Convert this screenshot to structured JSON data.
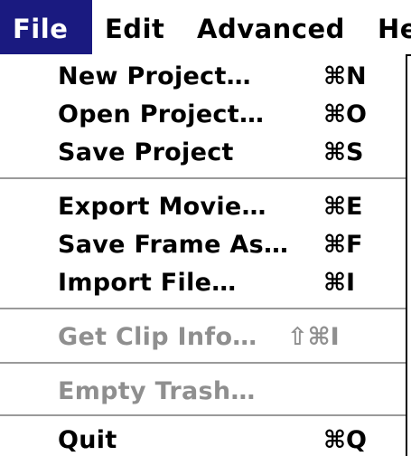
{
  "menubar": {
    "file": "File",
    "edit": "Edit",
    "advanced": "Advanced",
    "help_partial": "He",
    "active_color": "#1a1a80"
  },
  "file_menu": {
    "new_project": {
      "label": "New Project…",
      "shortcut": "⌘N"
    },
    "open_project": {
      "label": "Open Project…",
      "shortcut": "⌘O"
    },
    "save_project": {
      "label": "Save Project",
      "shortcut": "⌘S"
    },
    "export_movie": {
      "label": "Export Movie…",
      "shortcut": "⌘E"
    },
    "save_frame_as": {
      "label": "Save Frame As…",
      "shortcut": "⌘F"
    },
    "import_file": {
      "label": "Import File…",
      "shortcut": "⌘I"
    },
    "get_clip_info": {
      "label": "Get Clip Info…",
      "shortcut": "⇧⌘I",
      "disabled": true
    },
    "empty_trash": {
      "label": "Empty Trash…",
      "shortcut": "",
      "disabled": true
    },
    "quit": {
      "label": "Quit",
      "shortcut": "⌘Q"
    }
  },
  "colors": {
    "disabled_text": "#8f8f8f",
    "separator": "#9a9a9a"
  }
}
